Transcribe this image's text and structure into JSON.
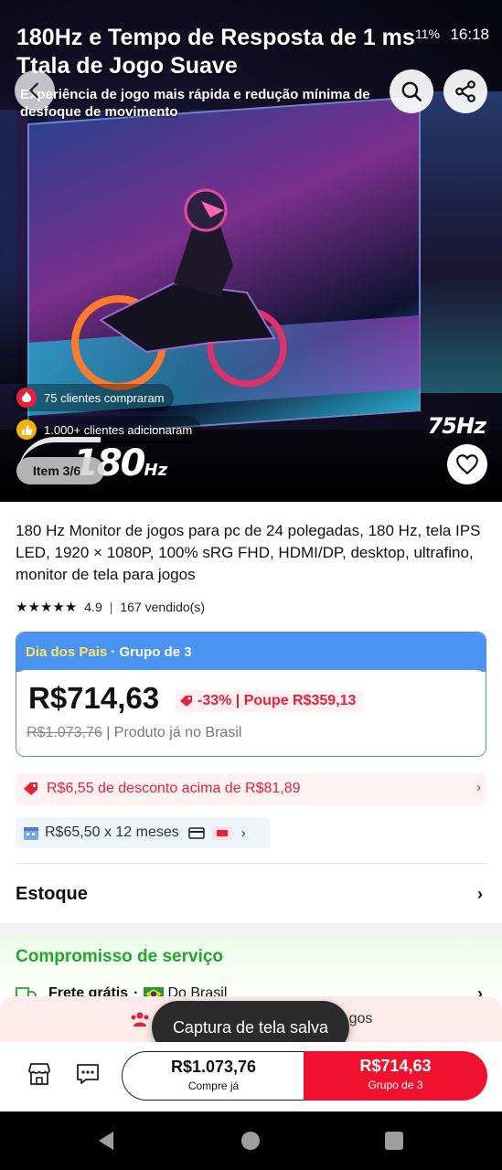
{
  "status_bar": {
    "time": "16:18",
    "battery": "11%"
  },
  "hero": {
    "title": "180Hz e Tempo de Resposta de 1 ms Ttala de Jogo Suave",
    "subtitle": "Experiência de jogo mais rápida e redução mínima de desfoque de movimento",
    "badge_buyers": "75 clientes compraram",
    "badge_added": "1.000+ clientes adicionaram",
    "hz_old": "75Hz",
    "hz_new": "180",
    "hz_unit": "Hz",
    "item_counter": "Item 3/6"
  },
  "product": {
    "title": "180 Hz Monitor de jogos para pc de 24 polegadas, 180 Hz, tela IPS LED, 1920 × 1080P, 100% sRG FHD, HDMI/DP, desktop, ultrafino, monitor de tela para jogos",
    "rating": "4.9",
    "sold": "167 vendido(s)"
  },
  "price_card": {
    "promo_name": "Dia dos Pais",
    "group_label": "· Grupo de 3",
    "price_now": "R$714,63",
    "discount": "-33% | Poupe R$359,13",
    "price_old": "R$1.073,76",
    "origin_note": "| Produto já no Brasil"
  },
  "coupon": {
    "text": "R$6,55 de desconto acima de R$81,89"
  },
  "installments": {
    "text": "R$65,50 x 12 meses"
  },
  "stock": {
    "label": "Estoque"
  },
  "service": {
    "title": "Compromisso de serviço",
    "shipping": "Frete grátis",
    "origin": "Do Brasil"
  },
  "group_strip": {
    "text": "gos"
  },
  "toast": {
    "text": "Captura de tela salva"
  },
  "action_bar": {
    "buy_alone_price": "R$1.073,76",
    "buy_alone_label": "Compre já",
    "buy_group_price": "R$714,63",
    "buy_group_label": "Grupo de 3"
  },
  "icons": {
    "back": "chevron-left-icon",
    "search": "search-icon",
    "share": "share-icon",
    "favorite": "heart-icon",
    "store": "store-icon",
    "chat": "chat-icon"
  },
  "colors": {
    "accent_red": "#f0112e",
    "promo_blue": "#4b93f2",
    "promo_yellow": "#ffe45c",
    "service_green": "#1fa82b"
  }
}
